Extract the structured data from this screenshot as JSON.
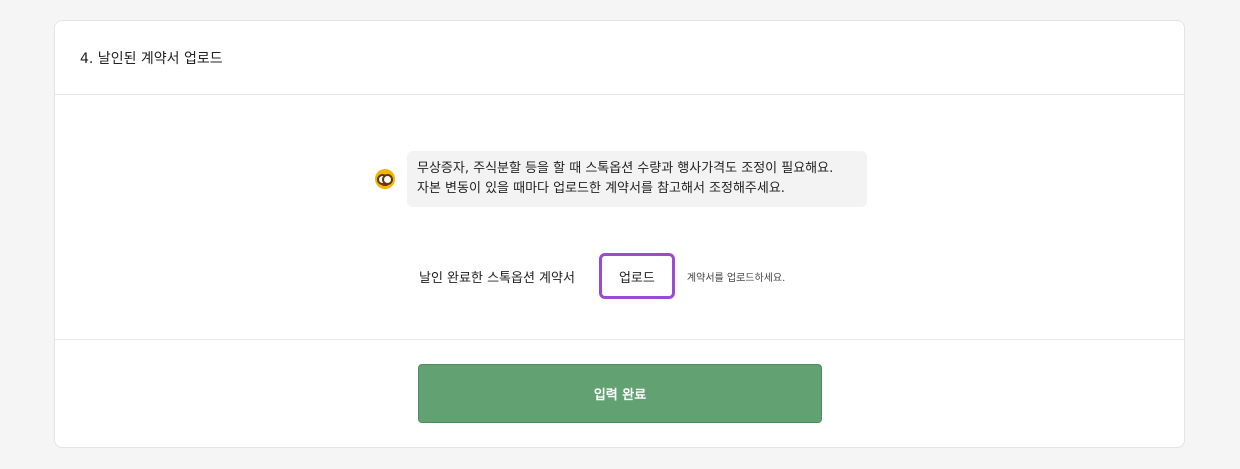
{
  "section": {
    "title": "4. 날인된 계약서 업로드"
  },
  "notice": {
    "icon": "nerd-face-emoji-icon",
    "line1": "무상증자, 주식분할 등을 할 때 스톡옵션 수량과 행사가격도 조정이 필요해요.",
    "line2": "자본 변동이 있을 때마다 업로드한 계약서를 참고해서 조정해주세요."
  },
  "upload": {
    "label": "날인 완료한 스톡옵션 계약서",
    "button_label": "업로드",
    "hint": "계약서를 업로드하세요."
  },
  "footer": {
    "submit_label": "입력 완료"
  },
  "colors": {
    "accent_border": "#9b4bd1",
    "submit_bg": "#61a172"
  }
}
